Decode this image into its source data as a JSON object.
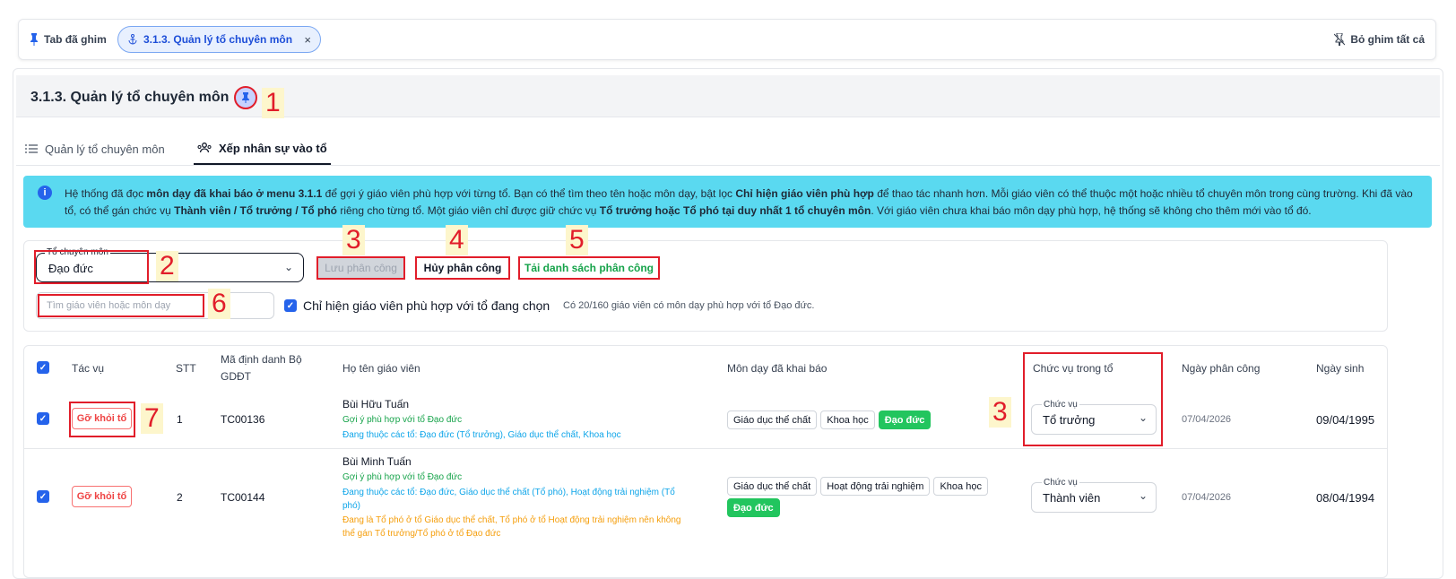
{
  "pinbar": {
    "label": "Tab đã ghim",
    "tab_label": "3.1.3. Quản lý tổ chuyên môn",
    "tab_close": "×",
    "unpin_all": "Bỏ ghim tất cả"
  },
  "page": {
    "title": "3.1.3. Quản lý tổ chuyên môn",
    "annotations": [
      "1",
      "2",
      "3",
      "4",
      "5",
      "6",
      "7",
      "3"
    ]
  },
  "tabs": [
    {
      "label": "Quản lý tổ chuyên môn"
    },
    {
      "label": "Xếp nhân sự vào tổ"
    }
  ],
  "info": {
    "p1": "Hệ thống đã đọc ",
    "b1": "môn dạy đã khai báo ở menu 3.1.1",
    "p2": " để gợi ý giáo viên phù hợp với từng tổ. Bạn có thể tìm theo tên hoặc môn dạy, bật lọc ",
    "b2": "Chỉ hiện giáo viên phù hợp",
    "p3": " để thao tác nhanh hơn. Mỗi giáo viên có thể thuộc một hoặc nhiều tổ chuyên môn trong cùng trường. Khi đã vào tổ, có thể gán chức vụ ",
    "b3": "Thành viên / Tổ trưởng / Tổ phó",
    "p4": " riêng cho từng tổ. Một giáo viên chỉ được giữ chức vụ ",
    "b4": "Tổ trưởng hoặc Tổ phó tại duy nhất 1 tổ chuyên môn",
    "p5": ". Với giáo viên chưa khai báo môn dạy phù hợp, hệ thống sẽ không cho thêm mới vào tổ đó."
  },
  "filters": {
    "group_label": "Tổ chuyên môn",
    "group_value": "Đạo đức",
    "save_label": "Lưu phân công",
    "cancel_label": "Hủy phân công",
    "download_label": "Tải danh sách phân công",
    "search_placeholder": "Tìm giáo viên hoặc môn dạy",
    "only_matching_label": "Chỉ hiện giáo viên phù hợp với tổ đang chọn",
    "count_text": "Có 20/160 giáo viên có môn dạy phù hợp với tổ Đạo đức."
  },
  "table": {
    "headers": {
      "action": "Tác vụ",
      "stt": "STT",
      "id_line1": "Mã định danh Bộ",
      "id_line2": "GDĐT",
      "name": "Họ tên giáo viên",
      "subjects": "Môn dạy đã khai báo",
      "role": "Chức vụ trong tổ",
      "assigned": "Ngày phân công",
      "dob": "Ngày sinh"
    },
    "rows": [
      {
        "remove_label": "Gỡ khỏi tổ",
        "stt": "1",
        "code": "TC00136",
        "name": "Bùi Hữu Tuấn",
        "suggest": "Gợi ý phù hợp với tổ Đạo đức",
        "member_of": "Đang thuộc các tổ: Đạo đức (Tổ trưởng), Giáo dục thể chất, Khoa học",
        "subjects": [
          "Giáo dục thể chất",
          "Khoa học",
          "Đạo đức"
        ],
        "role_label": "Chức vụ",
        "role_value": "Tổ trưởng",
        "assigned": "07/04/2026",
        "dob": "09/04/1995"
      },
      {
        "remove_label": "Gỡ khỏi tổ",
        "stt": "2",
        "code": "TC00144",
        "name": "Bùi Minh Tuấn",
        "suggest": "Gợi ý phù hợp với tổ Đạo đức",
        "member_of_1": "Đang thuộc các tổ: Đạo đức, Giáo dục thể chất (Tổ phó), Hoạt động trải nghiệm (Tổ",
        "member_of_2": "phó)",
        "warning_1": "Đang là Tổ phó ở tổ Giáo dục thể chất, Tổ phó ở tổ Hoạt động trải nghiệm nên không",
        "warning_2": "thể gán Tổ trưởng/Tổ phó ở tổ Đạo đức",
        "subjects": [
          "Giáo dục thể chất",
          "Hoạt động trải nghiệm",
          "Khoa học",
          "Đạo đức"
        ],
        "role_label": "Chức vụ",
        "role_value": "Thành viên",
        "assigned": "07/04/2026",
        "dob": "08/04/1994"
      }
    ]
  },
  "icons": {
    "check": "✓",
    "chevron": "⌄",
    "info": "i"
  }
}
